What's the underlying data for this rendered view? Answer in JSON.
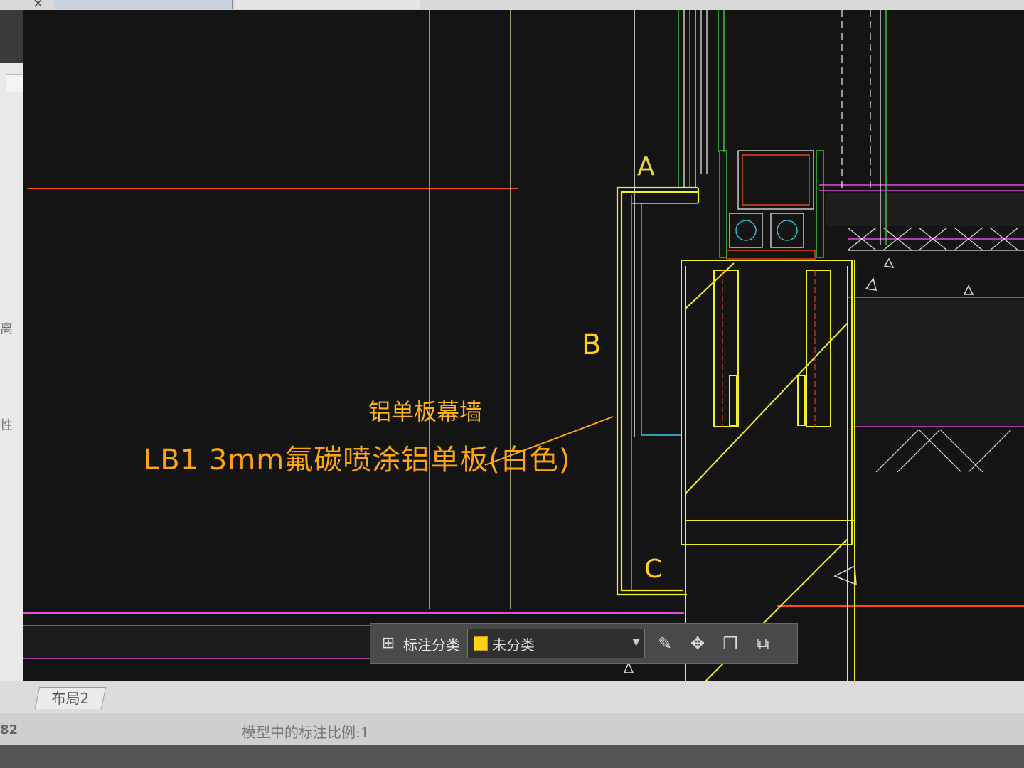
{
  "window": {
    "close_glyph": "×"
  },
  "side_panel": {
    "fragment_1": "离",
    "fragment_2": "性"
  },
  "drawing": {
    "label_a": "A",
    "label_b": "B",
    "label_c": "C",
    "note_title": "铝单板幕墙",
    "note_main": "LB1 3mm氟碳喷涂铝单板(白色)",
    "colors": {
      "background": "#141414",
      "outline_yellow": "#f3ec2c",
      "annotation_orange": "#ffa514",
      "red_line": "#ff4a1a",
      "magenta_line": "#e04ce0",
      "cyan_line": "#2fd2e6",
      "green_line": "#3adc4a"
    }
  },
  "annotation_toolbar": {
    "category_label": "标注分类",
    "selected_value": "未分类",
    "swatch_color": "#ffd21a",
    "icons": [
      "annotation-category-icon",
      "edit-icon",
      "move-icon",
      "copy-icon",
      "paste-icon"
    ]
  },
  "bottom_tabs": {
    "layout_tab": "布局2"
  },
  "status_bar": {
    "coordinate_fragment": "82",
    "annotation_scale": "模型中的标注比例:1"
  }
}
